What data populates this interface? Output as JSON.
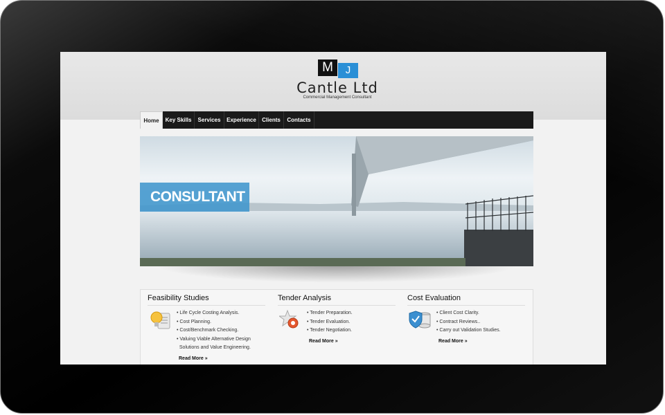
{
  "logo": {
    "m": "M",
    "j": "J",
    "title": "Cantle Ltd",
    "subtitle": "Commercial Management Consultant"
  },
  "nav": {
    "items": [
      "Home",
      "Key Skills",
      "Services",
      "Experience",
      "Clients",
      "Contacts"
    ]
  },
  "hero": {
    "badge": "CONSULTANT"
  },
  "services": [
    {
      "title": "Feasibility Studies",
      "items": [
        "• Life Cycle Costing Analysis.",
        "• Cost Planning.",
        "• Cost/Benchmark Checking.",
        "• Valuing Viable Alternative Design",
        "  Solutions and Value Engineering."
      ],
      "read_more": "Read More »",
      "icon": "lightbulb-document-icon"
    },
    {
      "title": "Tender Analysis",
      "items": [
        "• Tender Preparation.",
        "• Tender Evaluation.",
        "• Tender Negotiation."
      ],
      "read_more": "Read More »",
      "icon": "star-gear-icon"
    },
    {
      "title": "Cost Evaluation",
      "items": [
        "• Client Cost Clarity.",
        "• Contract Reviews..",
        "• Carry out Validation Studies."
      ],
      "read_more": "Read More »",
      "icon": "shield-database-icon"
    }
  ],
  "colors": {
    "accent": "#2a8fd6",
    "nav_bg": "#1a1a1a"
  }
}
